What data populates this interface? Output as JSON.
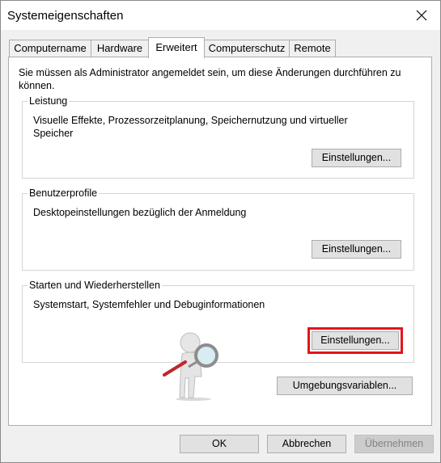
{
  "window": {
    "title": "Systemeigenschaften"
  },
  "tabs": [
    {
      "label": "Computername"
    },
    {
      "label": "Hardware"
    },
    {
      "label": "Erweitert"
    },
    {
      "label": "Computerschutz"
    },
    {
      "label": "Remote"
    }
  ],
  "active_tab": "Erweitert",
  "info_text": "Sie müssen als Administrator angemeldet sein, um diese Änderungen durchführen zu können.",
  "groups": {
    "leistung": {
      "title": "Leistung",
      "description": "Visuelle Effekte, Prozessorzeitplanung, Speichernutzung und virtueller Speicher",
      "button": "Einstellungen..."
    },
    "benutzerprofile": {
      "title": "Benutzerprofile",
      "description": "Desktopeinstellungen bezüglich der Anmeldung",
      "button": "Einstellungen..."
    },
    "starten": {
      "title": "Starten und Wiederherstellen",
      "description": "Systemstart, Systemfehler und Debuginformationen",
      "button": "Einstellungen..."
    }
  },
  "env_button": "Umgebungsvariablen...",
  "footer": {
    "ok": "OK",
    "cancel": "Abbrechen",
    "apply": "Übernehmen"
  },
  "colors": {
    "highlight": "#e3141b",
    "magnifier_handle": "#c0262c"
  },
  "icons": {
    "close": "close-icon",
    "figure": "magnifier-person-icon"
  }
}
